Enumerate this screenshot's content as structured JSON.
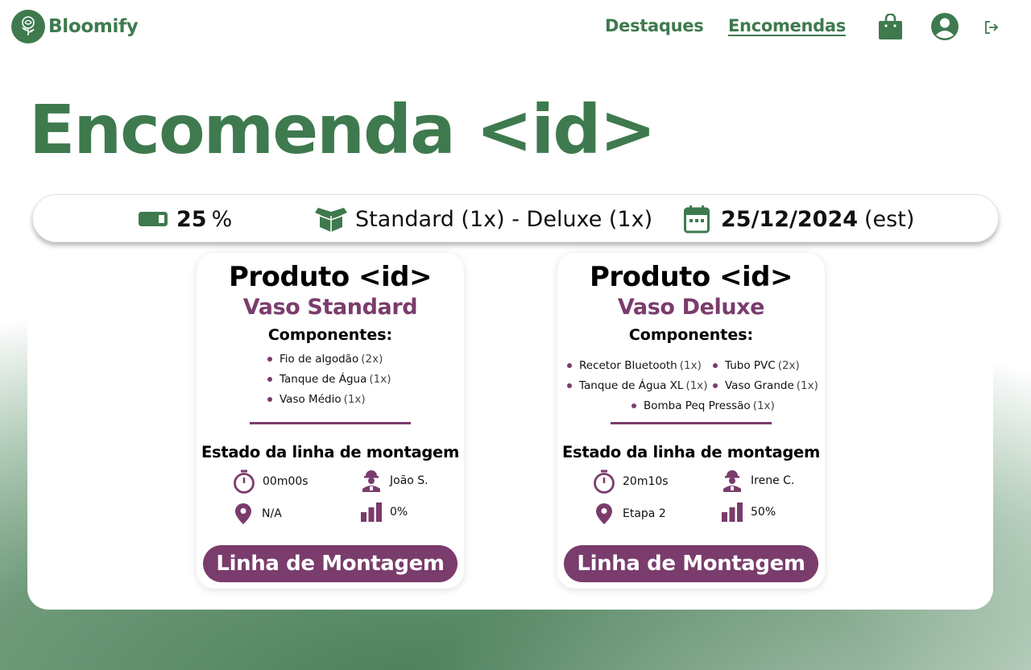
{
  "app": {
    "name": "Bloomify",
    "logo_icon": "rose-icon"
  },
  "nav": {
    "destaques": "Destaques",
    "encomendas": "Encomendas",
    "icons": [
      "shopping-bag-icon",
      "user-avatar-icon",
      "logout-icon"
    ]
  },
  "page": {
    "title": "Encomenda <id>"
  },
  "summary": {
    "progress_value": "25",
    "progress_unit": "%",
    "progress_fraction": 0.25,
    "models": "Standard (1x) - Deluxe (1x)",
    "date": "25/12/2024",
    "date_note": "(est)"
  },
  "products": [
    {
      "title": "Produto <id>",
      "name": "Vaso Standard",
      "components_label": "Componentes:",
      "components": [
        {
          "name": "Fio de algodão",
          "qty": "(2x)"
        },
        {
          "name": "Tanque de Água",
          "qty": "(1x)"
        },
        {
          "name": "Vaso Médio",
          "qty": "(1x)"
        }
      ],
      "state_title": "Estado da linha de montagem",
      "time": "00m00s",
      "worker": "João S.",
      "location": "N/A",
      "progress": "0%",
      "button": "Linha de Montagem"
    },
    {
      "title": "Produto <id>",
      "name": "Vaso Deluxe",
      "components_label": "Componentes:",
      "components": [
        {
          "name": "Recetor Bluetooth",
          "qty": "(1x)"
        },
        {
          "name": "Tubo PVC",
          "qty": "(2x)"
        },
        {
          "name": "Tanque de Água XL",
          "qty": "(1x)"
        },
        {
          "name": "Vaso Grande",
          "qty": "(1x)"
        },
        {
          "name": "Bomba Peq Pressão",
          "qty": "(1x)"
        }
      ],
      "state_title": "Estado da linha de montagem",
      "time": "20m10s",
      "worker": "Irene C.",
      "location": "Etapa 2",
      "progress": "50%",
      "button": "Linha de Montagem"
    }
  ],
  "colors": {
    "green": "#3e7a4e",
    "purple": "#7a3c6c"
  }
}
